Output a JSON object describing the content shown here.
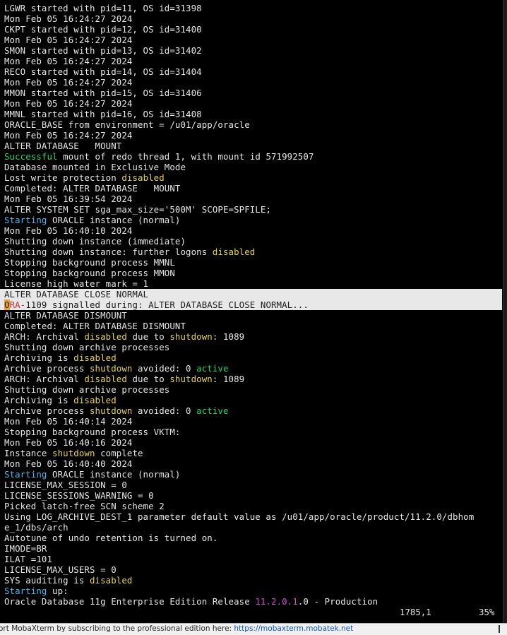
{
  "terminal": {
    "lines": [
      [
        {
          "t": "LGWR started with pid=11, OS id=31398"
        }
      ],
      [
        {
          "t": "Mon Feb 05 16:24:27 2024"
        }
      ],
      [
        {
          "t": "CKPT started with pid=12, OS id=31400"
        }
      ],
      [
        {
          "t": "Mon Feb 05 16:24:27 2024"
        }
      ],
      [
        {
          "t": "SMON started with pid=13, OS id=31402"
        }
      ],
      [
        {
          "t": "Mon Feb 05 16:24:27 2024"
        }
      ],
      [
        {
          "t": "RECO started with pid=14, OS id=31404"
        }
      ],
      [
        {
          "t": "Mon Feb 05 16:24:27 2024"
        }
      ],
      [
        {
          "t": "MMON started with pid=15, OS id=31406"
        }
      ],
      [
        {
          "t": "Mon Feb 05 16:24:27 2024"
        }
      ],
      [
        {
          "t": "MMNL started with pid=16, OS id=31408"
        }
      ],
      [
        {
          "t": "ORACLE_BASE from environment = /u01/app/oracle"
        }
      ],
      [
        {
          "t": "Mon Feb 05 16:24:27 2024"
        }
      ],
      [
        {
          "t": "ALTER DATABASE   MOUNT"
        }
      ],
      [
        {
          "t": "Successful",
          "c": "green"
        },
        {
          "t": " mount of redo thread 1, with mount id 571992507"
        }
      ],
      [
        {
          "t": "Database mounted in Exclusive Mode"
        }
      ],
      [
        {
          "t": "Lost write protection "
        },
        {
          "t": "disabled",
          "c": "yellow"
        }
      ],
      [
        {
          "t": "Completed: ALTER DATABASE   MOUNT"
        }
      ],
      [
        {
          "t": "Mon Feb 05 16:39:54 2024"
        }
      ],
      [
        {
          "t": "ALTER SYSTEM SET sga_max_size='500M' SCOPE=SPFILE;"
        }
      ],
      [
        {
          "t": "Starting",
          "c": "cyan"
        },
        {
          "t": " ORACLE instance (normal)"
        }
      ],
      [
        {
          "t": "Mon Feb 05 16:40:10 2024"
        }
      ],
      [
        {
          "t": "Shutting down instance (immediate)"
        }
      ],
      [
        {
          "t": "Shutting down instance: further logons "
        },
        {
          "t": "disabled",
          "c": "yellow"
        }
      ],
      [
        {
          "t": "Stopping background process MMNL"
        }
      ],
      [
        {
          "t": "Stopping background process MMON"
        }
      ],
      [
        {
          "t": "License high water mark = 1"
        }
      ],
      [
        {
          "t": "ALTER DATABASE CLOSE NORMAL",
          "hl": true
        }
      ],
      [
        {
          "t": "O",
          "c": "cursor",
          "hl": true
        },
        {
          "t": "RA-",
          "c": "hlred",
          "hl": true
        },
        {
          "t": "1109 signalled during: ALTER DATABASE CLOSE NORMAL...",
          "hl": true
        }
      ],
      [
        {
          "t": "ALTER DATABASE DISMOUNT"
        }
      ],
      [
        {
          "t": "Completed: ALTER DATABASE DISMOUNT"
        }
      ],
      [
        {
          "t": "ARCH: Archival "
        },
        {
          "t": "disabled",
          "c": "yellow"
        },
        {
          "t": " due to "
        },
        {
          "t": "shutdown",
          "c": "yellow"
        },
        {
          "t": ": 1089"
        }
      ],
      [
        {
          "t": "Shutting down archive processes"
        }
      ],
      [
        {
          "t": "Archiving is "
        },
        {
          "t": "disabled",
          "c": "yellow"
        }
      ],
      [
        {
          "t": "Archive process "
        },
        {
          "t": "shutdown",
          "c": "yellow"
        },
        {
          "t": " avoided: 0 "
        },
        {
          "t": "active",
          "c": "green"
        }
      ],
      [
        {
          "t": "ARCH: Archival "
        },
        {
          "t": "disabled",
          "c": "yellow"
        },
        {
          "t": " due to "
        },
        {
          "t": "shutdown",
          "c": "yellow"
        },
        {
          "t": ": 1089"
        }
      ],
      [
        {
          "t": "Shutting down archive processes"
        }
      ],
      [
        {
          "t": "Archiving is "
        },
        {
          "t": "disabled",
          "c": "yellow"
        }
      ],
      [
        {
          "t": "Archive process "
        },
        {
          "t": "shutdown",
          "c": "yellow"
        },
        {
          "t": " avoided: 0 "
        },
        {
          "t": "active",
          "c": "green"
        }
      ],
      [
        {
          "t": "Mon Feb 05 16:40:14 2024"
        }
      ],
      [
        {
          "t": "Stopping background process VKTM:"
        }
      ],
      [
        {
          "t": "Mon Feb 05 16:40:16 2024"
        }
      ],
      [
        {
          "t": "Instance "
        },
        {
          "t": "shutdown",
          "c": "yellow"
        },
        {
          "t": " complete"
        }
      ],
      [
        {
          "t": "Mon Feb 05 16:40:40 2024"
        }
      ],
      [
        {
          "t": "Starting",
          "c": "cyan"
        },
        {
          "t": " ORACLE instance (normal)"
        }
      ],
      [
        {
          "t": "LICENSE_MAX_SESSION = 0"
        }
      ],
      [
        {
          "t": "LICENSE_SESSIONS_WARNING = 0"
        }
      ],
      [
        {
          "t": "Picked latch-free SCN scheme 2"
        }
      ],
      [
        {
          "t": "Using LOG_ARCHIVE_DEST_1 parameter default value as /u01/app/oracle/product/11.2.0/dbhom"
        }
      ],
      [
        {
          "t": "e_1/dbs/arch"
        }
      ],
      [
        {
          "t": "Autotune of undo retention is turned on."
        }
      ],
      [
        {
          "t": "IMODE=BR"
        }
      ],
      [
        {
          "t": "ILAT =101"
        }
      ],
      [
        {
          "t": "LICENSE_MAX_USERS = 0"
        }
      ],
      [
        {
          "t": "SYS auditing is "
        },
        {
          "t": "disabled",
          "c": "yellow"
        }
      ],
      [
        {
          "t": "Starting",
          "c": "cyan"
        },
        {
          "t": " up:"
        }
      ],
      [
        {
          "t": "Oracle Database 11g Enterprise Edition Release "
        },
        {
          "t": "11.2.0.1",
          "c": "magenta"
        },
        {
          "t": ".0 - Production"
        }
      ]
    ],
    "ruler_position": "1785,1",
    "ruler_percent": "35%"
  },
  "footer": {
    "text": "ort MobaXterm by subscribing to the professional edition here:  ",
    "link": "https://mobaxterm.mobatek.net"
  },
  "colors": {
    "background": "#000000",
    "text": "#e6e6e6",
    "green": "#1ed36a",
    "yellow": "#e8d34a",
    "cyan": "#4fb6ee",
    "magenta": "#d34fd3",
    "highlight": "#e8e8e8"
  }
}
